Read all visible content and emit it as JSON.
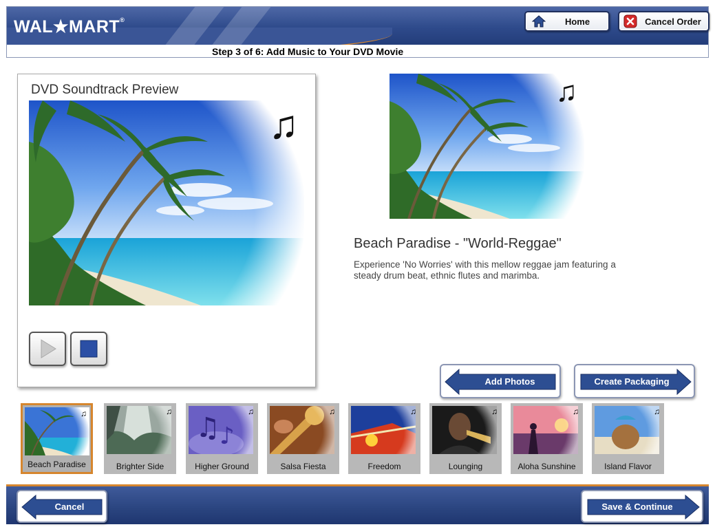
{
  "header": {
    "logo_text": "WAL",
    "logo_star": "★",
    "logo_text2": "MART",
    "logo_mark": "®",
    "step_title": "Step 3 of 6: Add Music to Your DVD Movie",
    "home_label": "Home",
    "cancel_order_label": "Cancel Order"
  },
  "preview": {
    "title": "DVD Soundtrack Preview"
  },
  "selected_song": {
    "title": "Beach Paradise - \"World-Reggae\"",
    "description": "Experience 'No Worries' with this mellow reggae jam featuring  a steady drum beat, ethnic flutes and marimba."
  },
  "navigation": {
    "add_photos_label": "Add Photos",
    "create_packaging_label": "Create Packaging"
  },
  "soundtracks": [
    {
      "label": "Beach Paradise",
      "selected": true,
      "theme": "beach"
    },
    {
      "label": "Brighter Side",
      "selected": false,
      "theme": "waterfall"
    },
    {
      "label": "Higher Ground",
      "selected": false,
      "theme": "music-notes"
    },
    {
      "label": "Salsa Fiesta",
      "selected": false,
      "theme": "trumpet"
    },
    {
      "label": "Freedom",
      "selected": false,
      "theme": "guitar"
    },
    {
      "label": "Lounging",
      "selected": false,
      "theme": "jazz-trumpet"
    },
    {
      "label": "Aloha Sunshine",
      "selected": false,
      "theme": "hula-sunset"
    },
    {
      "label": "Island Flavor",
      "selected": false,
      "theme": "coconut"
    }
  ],
  "footer": {
    "cancel_label": "Cancel",
    "save_label": "Save & Continue"
  },
  "icons": {
    "music_note": "♫",
    "home": "house-icon",
    "cancel_order": "close-icon",
    "play": "play-icon",
    "stop": "stop-icon"
  },
  "colors": {
    "brand_blue": "#2e4a8b",
    "accent_orange": "#d6862e",
    "button_blue": "#2d4e92"
  }
}
